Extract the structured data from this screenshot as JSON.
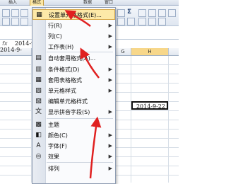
{
  "menubar": {
    "insert": "插入",
    "format": "格式",
    "data": "数据",
    "window": "窗口"
  },
  "formula": {
    "fx": "fx",
    "value": "2014-9-"
  },
  "columns": {
    "g": "G",
    "h": "H"
  },
  "cells": {
    "left_partial": "2014-9-",
    "selected_date": "2014-9-22"
  },
  "ribbon": {
    "sum_icon": "Σ"
  },
  "menu": {
    "items": [
      {
        "label": "设置单元格格式(E)...",
        "icon": "format-cells-icon",
        "submenu": false
      },
      {
        "label": "行(R)",
        "icon": "",
        "submenu": true
      },
      {
        "label": "列(C)",
        "icon": "",
        "submenu": true
      },
      {
        "label": "工作表(H)",
        "icon": "",
        "submenu": true
      },
      {
        "label": "自动套用格式(A)...",
        "icon": "autoformat-icon",
        "submenu": false
      },
      {
        "label": "条件格式(D)",
        "icon": "conditional-format-icon",
        "submenu": true
      },
      {
        "label": "套用表格格式",
        "icon": "table-style-icon",
        "submenu": true
      },
      {
        "label": "单元格样式",
        "icon": "cell-style-icon",
        "submenu": true
      },
      {
        "label": "编辑单元格样式",
        "icon": "edit-style-icon",
        "submenu": false
      },
      {
        "label": "显示拼音字段(S)",
        "icon": "phonetic-icon",
        "submenu": true
      },
      {
        "label": "主题",
        "icon": "theme-icon",
        "submenu": false
      },
      {
        "label": "颜色(C)",
        "icon": "color-icon",
        "submenu": true
      },
      {
        "label": "字体(F)",
        "icon": "font-icon",
        "submenu": true
      },
      {
        "label": "效果",
        "icon": "effects-icon",
        "submenu": true
      },
      {
        "label": "排列",
        "icon": "",
        "submenu": true
      }
    ]
  },
  "colors": {
    "highlight": "#fde9a8",
    "arrow": "#e02020"
  }
}
